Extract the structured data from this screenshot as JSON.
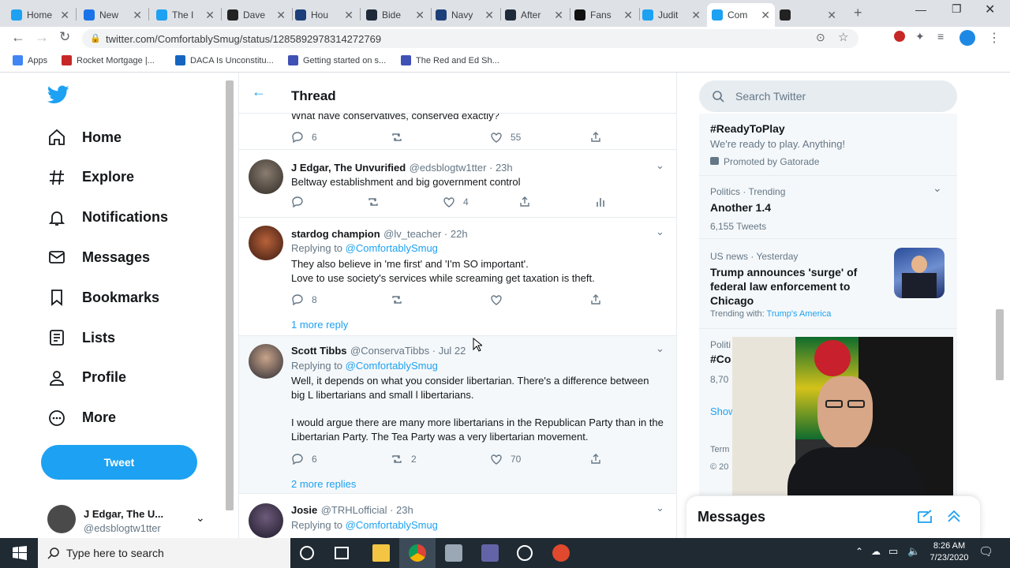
{
  "browser": {
    "tabs": [
      {
        "label": "Home",
        "icon": "twitter-icon",
        "color": "#1da1f2"
      },
      {
        "label": "New",
        "icon": "globe-icon",
        "color": "#1a73e8"
      },
      {
        "label": "The I",
        "icon": "twitter-icon",
        "color": "#1da1f2"
      },
      {
        "label": "Dave",
        "icon": "v-logo-icon",
        "color": "#222222"
      },
      {
        "label": "Hou",
        "icon": "flag-icon",
        "color": "#1c3f7a"
      },
      {
        "label": "Bide",
        "icon": "dw-icon",
        "color": "#1e2a3a"
      },
      {
        "label": "Navy",
        "icon": "flag-icon",
        "color": "#1c3f7a"
      },
      {
        "label": "After",
        "icon": "dw-icon",
        "color": "#1e2a3a"
      },
      {
        "label": "Fans",
        "icon": "c-logo-icon",
        "color": "#111111"
      },
      {
        "label": "Judit",
        "icon": "twitter-icon",
        "color": "#1da1f2"
      },
      {
        "label": "Com",
        "icon": "twitter-icon",
        "color": "#1da1f2",
        "active": true
      },
      {
        "label": "",
        "icon": "r-logo-icon",
        "color": "#222222"
      }
    ],
    "url": "twitter.com/ComfortablySmug/status/1285892978314272769",
    "bookmarks": [
      {
        "label": "Apps",
        "icon": "apps-icon"
      },
      {
        "label": "Rocket Mortgage |...",
        "icon": "rocket-icon"
      },
      {
        "label": "DACA Is Unconstitu...",
        "icon": "building-icon"
      },
      {
        "label": "Getting started on s...",
        "icon": "doc-icon"
      },
      {
        "label": "The Red and Ed Sh...",
        "icon": "doc-icon"
      }
    ]
  },
  "sidebar": {
    "items": [
      {
        "label": "Home",
        "icon": "home-icon"
      },
      {
        "label": "Explore",
        "icon": "hashtag-icon"
      },
      {
        "label": "Notifications",
        "icon": "bell-icon"
      },
      {
        "label": "Messages",
        "icon": "mail-icon"
      },
      {
        "label": "Bookmarks",
        "icon": "bookmark-icon"
      },
      {
        "label": "Lists",
        "icon": "list-icon"
      },
      {
        "label": "Profile",
        "icon": "person-icon"
      },
      {
        "label": "More",
        "icon": "more-icon"
      }
    ],
    "tweet_button": "Tweet",
    "account": {
      "name": "J Edgar, The U...",
      "handle": "@edsblogtw1tter"
    }
  },
  "thread": {
    "title": "Thread",
    "top_partial_text": "What have conservatives, conserved exactly?",
    "top_actions": {
      "replies": "6",
      "likes": "55"
    },
    "tweets": [
      {
        "name": "J Edgar, The Unvurified",
        "handle": "@edsblogtw1tter · 23h",
        "replying": "",
        "text": "Beltway establishment and big government control",
        "replies": "",
        "retweets": "",
        "likes": "4"
      },
      {
        "name": "stardog champion",
        "handle": "@lv_teacher · 22h",
        "replying_prefix": "Replying to",
        "replying": "@ComfortablySmug",
        "text": "They also believe in 'me first' and 'I'm SO important'.",
        "text2": "Love to use society's services while screaming get taxation is theft.",
        "replies": "8",
        "retweets": "",
        "likes": "",
        "more_replies": "1 more reply"
      },
      {
        "name": "Scott Tibbs",
        "handle": "@ConservaTibbs · Jul 22",
        "replying_prefix": "Replying to",
        "replying": "@ComfortablySmug",
        "text": "Well, it depends on what you consider libertarian. There's a difference between big L libertarians and small l libertarians.",
        "text2": "I would argue there are many more libertarians in the Republican Party than in the Libertarian Party. The Tea Party was a very libertarian movement.",
        "replies": "6",
        "retweets": "2",
        "likes": "70",
        "more_replies": "2 more replies"
      },
      {
        "name": "Josie",
        "handle": "@TRHLofficial · 23h",
        "replying_prefix": "Replying to",
        "replying": "@ComfortablySmug"
      }
    ]
  },
  "right": {
    "search_placeholder": "Search Twitter",
    "trends": [
      {
        "title": "#ReadyToPlay",
        "desc": "We're ready to play. Anything!",
        "meta": "Promoted by Gatorade"
      },
      {
        "context": "Politics · Trending",
        "title": "Another 1.4",
        "meta": "6,155 Tweets"
      },
      {
        "context": "US news · Yesterday",
        "title": "Trump announces 'surge' of federal law enforcement to Chicago",
        "meta_prefix": "Trending with:",
        "meta_link": "Trump's America"
      },
      {
        "context": "Politi",
        "title": "#Co",
        "meta": "8,70"
      }
    ],
    "show_more": "Show",
    "terms": "Term",
    "copyright": "© 20",
    "messages_title": "Messages"
  },
  "taskbar": {
    "search_placeholder": "Type here to search",
    "time": "8:26 AM",
    "date": "7/23/2020"
  },
  "colors": {
    "twitter_blue": "#1da1f2",
    "text_dark": "#14171a",
    "text_gray": "#657786"
  }
}
